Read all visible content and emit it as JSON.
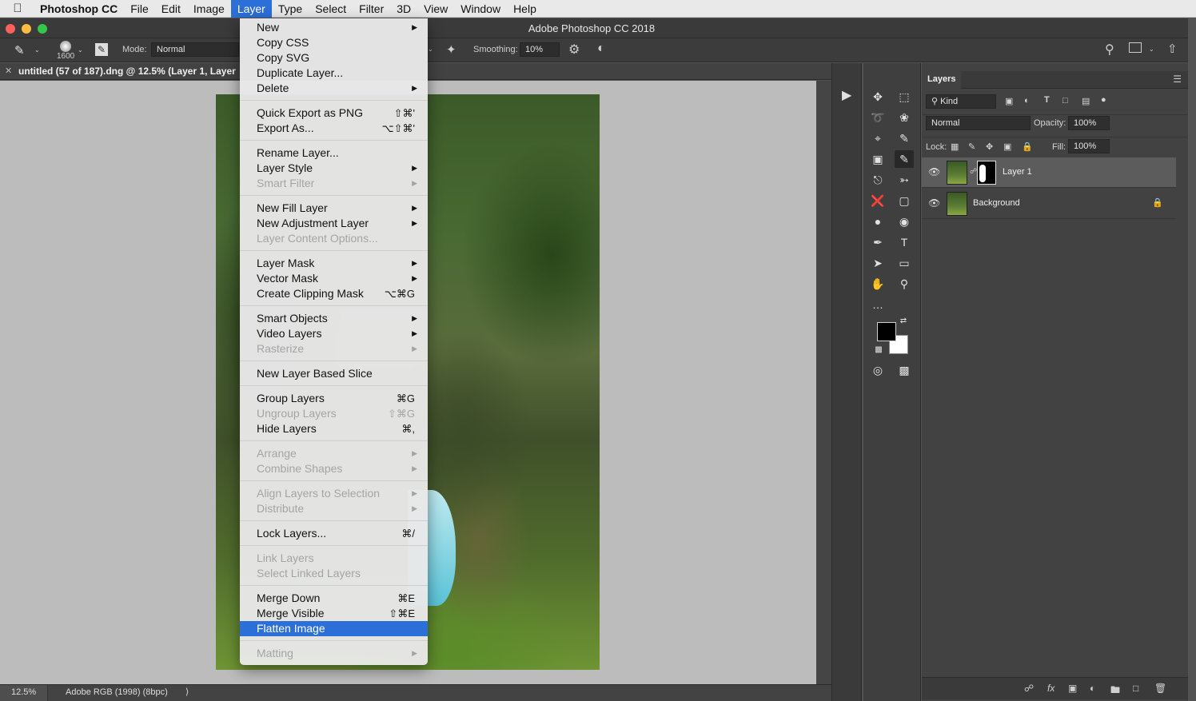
{
  "menubar": {
    "app": "Photoshop CC",
    "items": [
      "File",
      "Edit",
      "Image",
      "Layer",
      "Type",
      "Select",
      "Filter",
      "3D",
      "View",
      "Window",
      "Help"
    ],
    "active_index": 3
  },
  "window": {
    "title": "Adobe Photoshop CC 2018"
  },
  "options": {
    "brush_size": "1600",
    "mode_label": "Mode:",
    "mode_value": "Normal",
    "smoothing_label": "Smoothing:",
    "smoothing_value": "10%"
  },
  "doc_tab": {
    "title": "untitled (57 of 187).dng @ 12.5% (Layer 1, Layer"
  },
  "status": {
    "zoom": "12.5%",
    "profile": "Adobe RGB (1998) (8bpc)"
  },
  "layer_menu": {
    "groups": [
      [
        {
          "label": "New",
          "submenu": true,
          "enabled": true
        },
        {
          "label": "Copy CSS",
          "enabled": true
        },
        {
          "label": "Copy SVG",
          "enabled": true
        },
        {
          "label": "Duplicate Layer...",
          "enabled": true
        },
        {
          "label": "Delete",
          "submenu": true,
          "enabled": true
        }
      ],
      [
        {
          "label": "Quick Export as PNG",
          "shortcut": "⇧⌘'",
          "enabled": true
        },
        {
          "label": "Export As...",
          "shortcut": "⌥⇧⌘'",
          "enabled": true
        }
      ],
      [
        {
          "label": "Rename Layer...",
          "enabled": true
        },
        {
          "label": "Layer Style",
          "submenu": true,
          "enabled": true
        },
        {
          "label": "Smart Filter",
          "submenu": true,
          "enabled": false
        }
      ],
      [
        {
          "label": "New Fill Layer",
          "submenu": true,
          "enabled": true
        },
        {
          "label": "New Adjustment Layer",
          "submenu": true,
          "enabled": true
        },
        {
          "label": "Layer Content Options...",
          "enabled": false
        }
      ],
      [
        {
          "label": "Layer Mask",
          "submenu": true,
          "enabled": true
        },
        {
          "label": "Vector Mask",
          "submenu": true,
          "enabled": true
        },
        {
          "label": "Create Clipping Mask",
          "shortcut": "⌥⌘G",
          "enabled": true
        }
      ],
      [
        {
          "label": "Smart Objects",
          "submenu": true,
          "enabled": true
        },
        {
          "label": "Video Layers",
          "submenu": true,
          "enabled": true
        },
        {
          "label": "Rasterize",
          "submenu": true,
          "enabled": false
        }
      ],
      [
        {
          "label": "New Layer Based Slice",
          "enabled": true
        }
      ],
      [
        {
          "label": "Group Layers",
          "shortcut": "⌘G",
          "enabled": true
        },
        {
          "label": "Ungroup Layers",
          "shortcut": "⇧⌘G",
          "enabled": false
        },
        {
          "label": "Hide Layers",
          "shortcut": "⌘,",
          "enabled": true
        }
      ],
      [
        {
          "label": "Arrange",
          "submenu": true,
          "enabled": false
        },
        {
          "label": "Combine Shapes",
          "submenu": true,
          "enabled": false
        }
      ],
      [
        {
          "label": "Align Layers to Selection",
          "submenu": true,
          "enabled": false
        },
        {
          "label": "Distribute",
          "submenu": true,
          "enabled": false
        }
      ],
      [
        {
          "label": "Lock Layers...",
          "shortcut": "⌘/",
          "enabled": true
        }
      ],
      [
        {
          "label": "Link Layers",
          "enabled": false
        },
        {
          "label": "Select Linked Layers",
          "enabled": false
        }
      ],
      [
        {
          "label": "Merge Down",
          "shortcut": "⌘E",
          "enabled": true
        },
        {
          "label": "Merge Visible",
          "shortcut": "⇧⌘E",
          "enabled": true
        },
        {
          "label": "Flatten Image",
          "enabled": true,
          "highlighted": true
        }
      ],
      [
        {
          "label": "Matting",
          "submenu": true,
          "enabled": false
        }
      ]
    ]
  },
  "layers_panel": {
    "tab": "Layers",
    "filter_kind": "Kind",
    "blend_mode": "Normal",
    "opacity_label": "Opacity:",
    "opacity_value": "100%",
    "lock_label": "Lock:",
    "fill_label": "Fill:",
    "fill_value": "100%",
    "layers": [
      {
        "name": "Layer 1",
        "selected": true,
        "has_mask": true,
        "locked": false
      },
      {
        "name": "Background",
        "selected": false,
        "has_mask": false,
        "locked": true
      }
    ]
  },
  "colors": {
    "menu_highlight": "#2c6fd8",
    "foreground": "#000000",
    "background": "#ffffff"
  }
}
